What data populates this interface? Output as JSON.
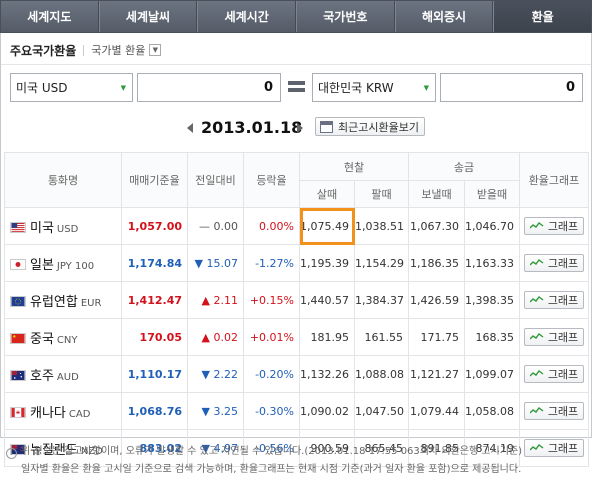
{
  "tabs": [
    {
      "label": "세계지도"
    },
    {
      "label": "세계날씨"
    },
    {
      "label": "세계시간"
    },
    {
      "label": "국가번호"
    },
    {
      "label": "해외증시"
    },
    {
      "label": "환율"
    }
  ],
  "subhead": {
    "title": "주요국가환율",
    "link": "국가별 환율"
  },
  "converter": {
    "from_currency": "미국 USD",
    "from_amount": "0",
    "to_currency": "대한민국 KRW",
    "to_amount": "0"
  },
  "date": "2013.01.18",
  "notice_button": "최근고시환율보기",
  "table": {
    "headers": {
      "currency": "통화명",
      "base_rate": "매매기준율",
      "change": "전일대비",
      "change_rate": "등락율",
      "cash": "현찰",
      "cash_buy": "살때",
      "cash_sell": "팔때",
      "transfer": "송금",
      "send": "보낼때",
      "receive": "받을때",
      "graph": "환율그래프"
    },
    "rows": [
      {
        "name": "미국",
        "code": "USD",
        "base": "1,057.00",
        "dir": "—",
        "change": "0.00",
        "rate": "0.00%",
        "cash_buy": "1,075.49",
        "cash_sell": "1,038.51",
        "send": "1,067.30",
        "receive": "1,046.70",
        "graph": "그래프",
        "color": "#d3121b",
        "flag": "us-flag-icon"
      },
      {
        "name": "일본",
        "code": "JPY 100",
        "base": "1,174.84",
        "dir": "▼",
        "change": "15.07",
        "rate": "-1.27%",
        "cash_buy": "1,195.39",
        "cash_sell": "1,154.29",
        "send": "1,186.35",
        "receive": "1,163.33",
        "graph": "그래프",
        "color": "#1f5fb8",
        "flag": "jp-flag-icon"
      },
      {
        "name": "유럽연합",
        "code": "EUR",
        "base": "1,412.47",
        "dir": "▲",
        "change": "2.11",
        "rate": "+0.15%",
        "cash_buy": "1,440.57",
        "cash_sell": "1,384.37",
        "send": "1,426.59",
        "receive": "1,398.35",
        "graph": "그래프",
        "color": "#d3121b",
        "flag": "eu-flag-icon"
      },
      {
        "name": "중국",
        "code": "CNY",
        "base": "170.05",
        "dir": "▲",
        "change": "0.02",
        "rate": "+0.01%",
        "cash_buy": "181.95",
        "cash_sell": "161.55",
        "send": "171.75",
        "receive": "168.35",
        "graph": "그래프",
        "color": "#d3121b",
        "flag": "cn-flag-icon"
      },
      {
        "name": "호주",
        "code": "AUD",
        "base": "1,110.17",
        "dir": "▼",
        "change": "2.22",
        "rate": "-0.20%",
        "cash_buy": "1,132.26",
        "cash_sell": "1,088.08",
        "send": "1,121.27",
        "receive": "1,099.07",
        "graph": "그래프",
        "color": "#1f5fb8",
        "flag": "au-flag-icon"
      },
      {
        "name": "캐나다",
        "code": "CAD",
        "base": "1,068.76",
        "dir": "▼",
        "change": "3.25",
        "rate": "-0.30%",
        "cash_buy": "1,090.02",
        "cash_sell": "1,047.50",
        "send": "1,079.44",
        "receive": "1,058.08",
        "graph": "그래프",
        "color": "#1f5fb8",
        "flag": "ca-flag-icon"
      },
      {
        "name": "뉴질랜드",
        "code": "NZD",
        "base": "883.02",
        "dir": "▼",
        "change": "4.97",
        "rate": "-0.56%",
        "cash_buy": "900.59",
        "cash_sell": "865.45",
        "send": "891.85",
        "receive": "874.19",
        "graph": "그래프",
        "color": "#1f5fb8",
        "flag": "nz-flag-icon"
      }
    ]
  },
  "notes": {
    "line1": "위 정보는 참고사항이며, 오류가 발생할 수 있고 지연될 수 있습니다.(2013.01.18 17:55 063회차 외환은행 고시기준)",
    "line2": "일자별 환율은 환율 고시일 기준으로 검색 가능하며, 환율그래프는 현재 시점 기준(과거 일자 환율 포함)으로 제공됩니다."
  }
}
